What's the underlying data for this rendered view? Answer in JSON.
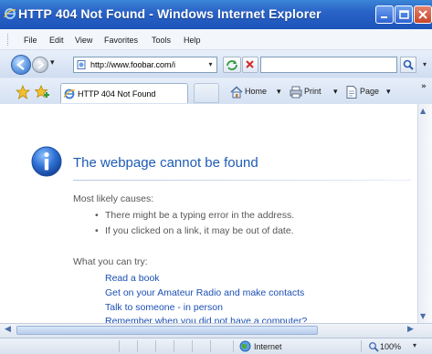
{
  "window": {
    "title": "HTTP 404 Not Found - Windows Internet Explorer"
  },
  "menu": {
    "items": [
      "File",
      "Edit",
      "View",
      "Favorites",
      "Tools",
      "Help"
    ]
  },
  "address": {
    "url": "http://www.foobar.com/i",
    "search_value": ""
  },
  "tab": {
    "label": "HTTP 404 Not Found"
  },
  "commands": {
    "home": "Home",
    "print": "Print",
    "page": "Page"
  },
  "content": {
    "title": "The webpage cannot be found",
    "causes_heading": "Most likely causes:",
    "causes": [
      "There might be a typing error in the address.",
      "If you clicked on a link, it may be out of date."
    ],
    "try_heading": "What you can try:",
    "links": [
      "Read a book",
      "Get on your Amateur Radio and make contacts",
      "Talk to someone - in person",
      "Remember when you did not have a computer?"
    ]
  },
  "status": {
    "zone": "Internet",
    "zoom": "100%"
  },
  "icons": {
    "app": "ie-logo-icon",
    "info": "info-icon",
    "zone": "globe-icon",
    "zoom": "magnifier-icon"
  },
  "colors": {
    "title_bar": "#2a63c7",
    "link": "#1b50b3",
    "heading": "#1c5bb4",
    "close_button": "#c8452a"
  }
}
